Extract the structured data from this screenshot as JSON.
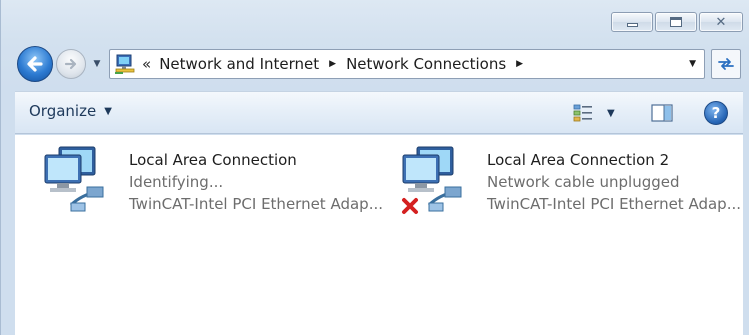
{
  "window": {
    "controls": {
      "minimize": "minimize-icon",
      "maximize": "maximize-icon",
      "close": "close-icon"
    }
  },
  "nav": {
    "back_icon": "back-arrow-icon",
    "forward_icon": "forward-arrow-icon",
    "recent_icon": "chevron-down-icon"
  },
  "address": {
    "icon": "network-folder-icon",
    "overflow": "«",
    "crumbs": [
      "Network and Internet",
      "Network Connections"
    ],
    "refresh_icon": "refresh-icon"
  },
  "toolbar": {
    "organize_label": "Organize",
    "views_icon": "change-view-icon",
    "preview_icon": "preview-pane-icon",
    "help_label": "?"
  },
  "connections": [
    {
      "name": "Local Area Connection",
      "status": "Identifying...",
      "adapter": "TwinCAT-Intel PCI Ethernet Adap...",
      "disconnected": false
    },
    {
      "name": "Local Area Connection 2",
      "status": "Network cable unplugged",
      "adapter": "TwinCAT-Intel PCI Ethernet Adap...",
      "disconnected": true
    }
  ],
  "colors": {
    "accent": "#2d7bd2",
    "toolbar_text": "#1e395b",
    "secondary_text": "#6d6d6d",
    "error_x": "#d42020"
  }
}
